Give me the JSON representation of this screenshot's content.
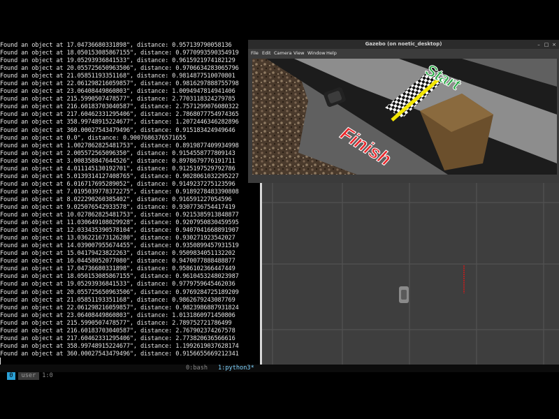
{
  "terminal": {
    "lines": [
      "Found an object at 17.04736680331898\", distance: 0.957139790058136",
      "Found an object at 18.050153085867155\", distance: 0.9770993590354919",
      "Found an object at 19.05293936841533\", distance: 0.9615921974182129",
      "Found an object at 20.055725650963506\", distance: 0.9706634283065796",
      "Found an object at 21.05851193351168\", distance: 0.9814877510070801",
      "Found an object at 22.061298216059857\", distance: 0.9816297888755798",
      "Found an object at 23.06408449860803\", distance: 1.0094947814941406",
      "Found an object at 215.5990507478577\", distance: 2.7703118324279785",
      "Found an object at 216.60183703040587\", distance: 2.7571299076080322",
      "Found an object at 217.60462331295406\", distance: 2.7868077754974365",
      "Found an object at 358.99748915224677\", distance: 1.2072446346282896",
      "Found an object at 360.00027543479496\", distance: 0.915183424949646",
      "Found an object at 0.0\", distance: 0.9007686376571655",
      "Found an object at 1.0027862825481753\", distance: 0.8919877409934998",
      "Found an object at 2.005572565096350\", distance: 0.9154558777809143",
      "Found an object at 3.008358847644526\", distance: 0.8978679776191711",
      "Found an object at 4.011145130192701\", distance: 0.9125197529792786",
      "Found an object at 5.0139314127408765\", distance: 0.9028061032295227",
      "Found an object at 6.016717695289052\", distance: 0.9149237275123596",
      "Found an object at 7.0195039778372275\", distance: 0.9189278483390808",
      "Found an object at 8.022290260385402\", distance: 0.916591227054596",
      "Found an object at 9.025076542933578\", distance: 0.9307736754417419",
      "Found an object at 10.027862825481753\", distance: 0.9215385913848877",
      "Found an object at 11.030649108029928\", distance: 0.9207950830459595",
      "Found an object at 12.033435390578104\", distance: 0.9407041668891907",
      "Found an object at 13.036221673126280\", distance: 0.930271923542027",
      "Found an object at 14.039007955674455\", distance: 0.9350899457931519",
      "Found an object at 15.04179423822263\", distance: 0.9509834051132202",
      "Found an object at 16.04458052077080\", distance: 0.9470077888488877",
      "Found an object at 17.04736680331898\", distance: 0.9586102366447449",
      "Found an object at 18.050153085867155\", distance: 0.9610453248023987",
      "Found an object at 19.05293936841533\", distance: 0.9779759645462036",
      "Found an object at 20.055725650963506\", distance: 0.9769284725189209",
      "Found an object at 21.05851193351168\", distance: 0.9862679243087769",
      "Found an object at 22.061298216059857\", distance: 0.9823986887931824",
      "Found an object at 23.06408449860803\", distance: 1.0131860971450806",
      "Found an object at 215.5990507478577\", distance: 2.789752721786499",
      "Found an object at 216.60183703040587\", distance: 2.767902374267578",
      "Found an object at 217.60462331295406\", distance: 2.773820636566616",
      "Found an object at 358.99748915224677\", distance: 1.1992619037628174",
      "Found an object at 360.00027543479496\", distance: 0.9156655669212341"
    ]
  },
  "tmux": {
    "session": "0",
    "user": "user",
    "pane": "1:0",
    "window0": "0:bash",
    "window1": "1:python3*"
  },
  "gazebo": {
    "title": "Gazebo (on noetic_desktop)",
    "menu": [
      "File",
      "Edit",
      "Camera",
      "View",
      "Window",
      "Help"
    ],
    "scene_text": {
      "start": "Start",
      "finish": "Finish"
    }
  },
  "colors": {
    "tmux_session": "#2aa0d6",
    "tmux_active_window": "#7fd4ff",
    "finish_text": "#e8262a",
    "start_text": "#27a844",
    "center_line": "#f2e600",
    "laser": "#d11a1a"
  },
  "icons": {
    "robot_top_view": "robot-icon",
    "window_close": "close-icon",
    "window_minimize": "minimize-icon",
    "window_maximize": "maximize-icon"
  }
}
